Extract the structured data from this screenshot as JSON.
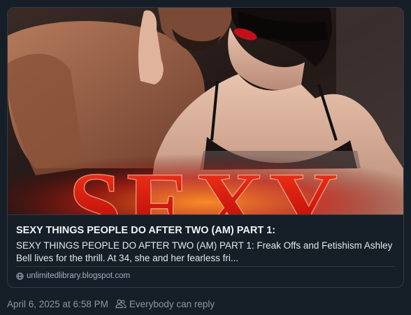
{
  "link_card": {
    "image_alt": "Book cover: a couple embracing, the woman blindfolded with red lips, large red title text",
    "image_text": "SEXY",
    "title": "SEXY THINGS PEOPLE DO AFTER TWO (AM) PART 1:",
    "description_line1": "SEXY THINGS PEOPLE DO AFTER TWO (AM) PART 1: Freak Offs and Fetishism Ashley",
    "description_line2": "Bell lives for the thrill.  At 34, she and her fearless fri...",
    "domain": "unlimitedlibrary.blogspot.com",
    "domain_icon": "globe-icon"
  },
  "post_meta": {
    "timestamp": "April 6, 2025 at 6:58 PM",
    "reply_setting": "Everybody can reply",
    "reply_icon": "people-icon"
  },
  "colors": {
    "background": "#161e27",
    "border": "#2e3b4a",
    "title_text": "#f1f3f5",
    "muted_text": "#8b98a5",
    "cover_red": "#d81f14"
  }
}
